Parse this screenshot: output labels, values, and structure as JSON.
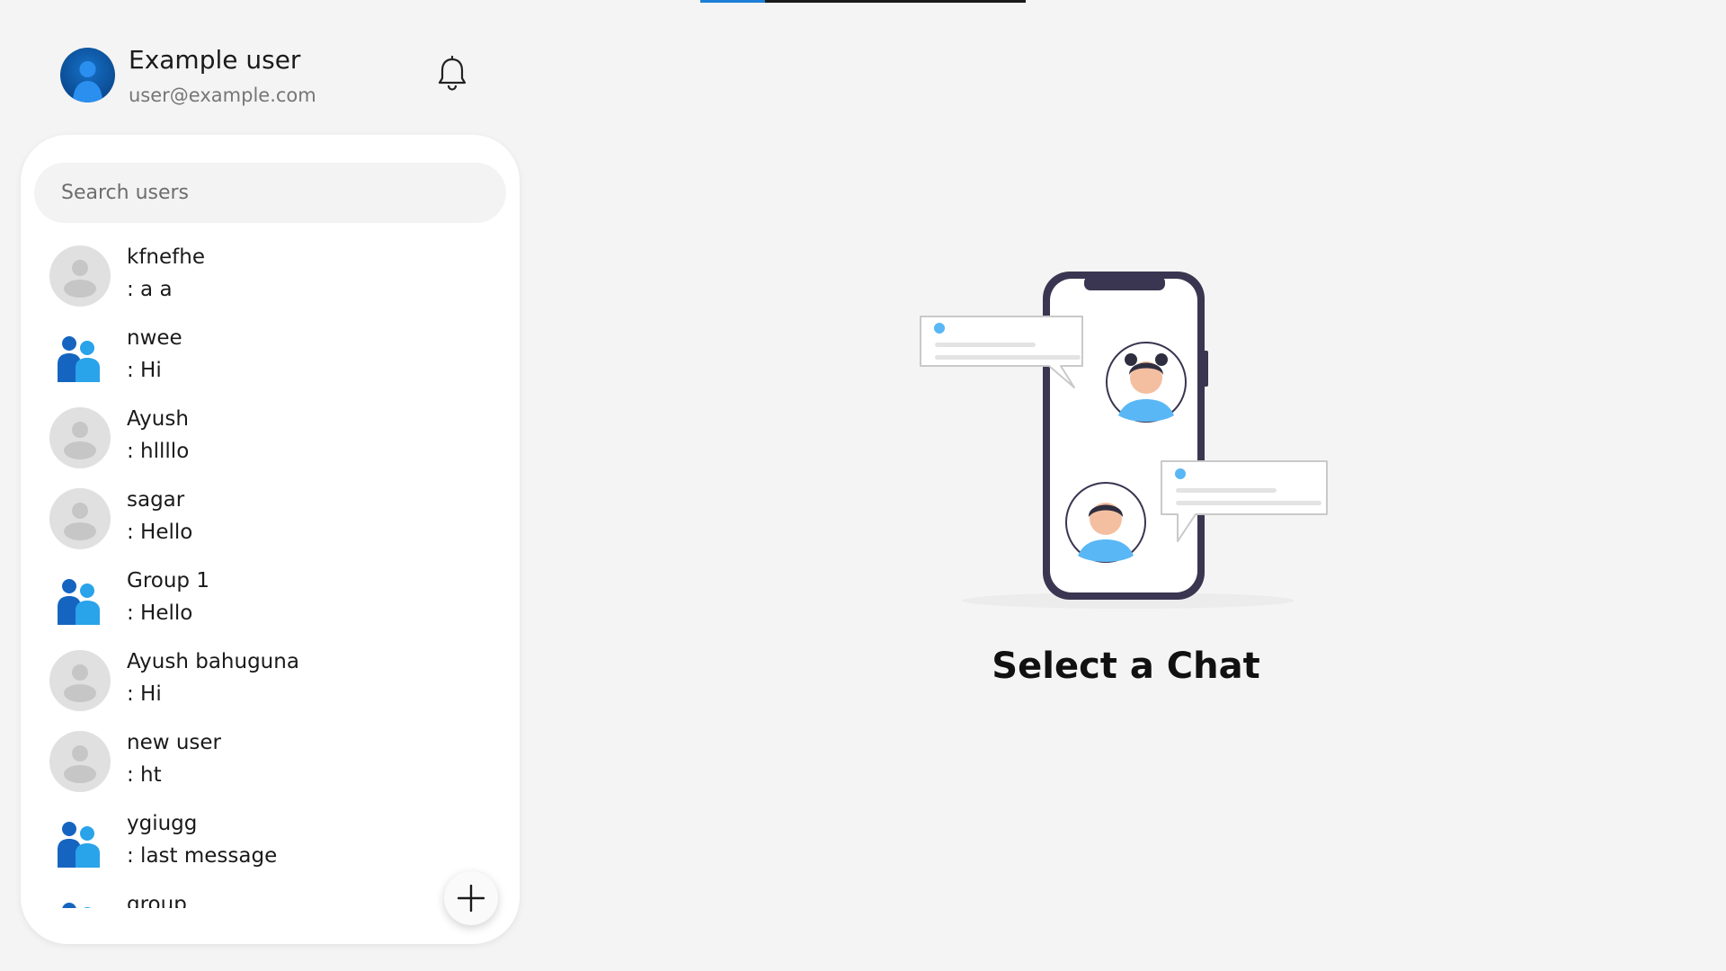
{
  "app": {
    "loading_progress": 0.2,
    "accent_color": "#1e7fd8"
  },
  "profile": {
    "name": "Example user",
    "email": "user@example.com",
    "avatar_icon": "user-avatar-icon",
    "notifications_icon": "bell-icon"
  },
  "sidebar": {
    "search_placeholder": "Search users",
    "chats": [
      {
        "name": "kfnefhe",
        "last_message": ": a a",
        "type": "user"
      },
      {
        "name": "nwee",
        "last_message": ": Hi",
        "type": "group"
      },
      {
        "name": "Ayush",
        "last_message": ": hllllo",
        "type": "user"
      },
      {
        "name": "sagar",
        "last_message": ": Hello",
        "type": "user"
      },
      {
        "name": "Group 1",
        "last_message": ": Hello",
        "type": "group"
      },
      {
        "name": "Ayush bahuguna",
        "last_message": ": Hi",
        "type": "user"
      },
      {
        "name": "new user",
        "last_message": ": ht",
        "type": "user"
      },
      {
        "name": "ygiugg",
        "last_message": ": last message",
        "type": "group"
      },
      {
        "name": "group",
        "last_message": "",
        "type": "group"
      }
    ],
    "new_chat_icon": "plus-icon"
  },
  "main": {
    "empty_title": "Select a Chat",
    "illustration": "phone-chat-illustration"
  }
}
